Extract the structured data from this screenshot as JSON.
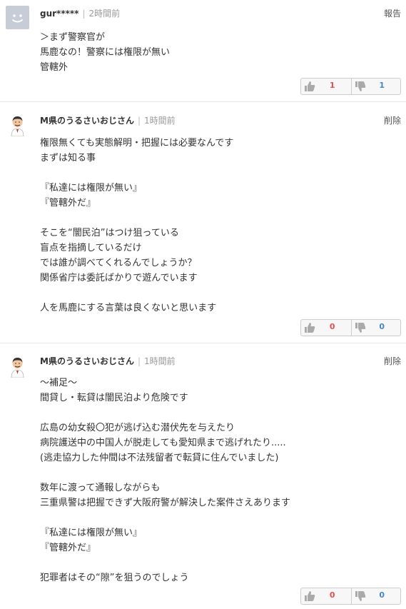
{
  "comments": [
    {
      "username": "gur*****",
      "time": "2時間前",
      "action": "報告",
      "lines": [
        "＞まず警察官が",
        "馬鹿なの！警察には権限が無い",
        "管轄外"
      ],
      "good": "1",
      "bad": "1"
    },
    {
      "username": "M県のうるさいおじさん",
      "time": "1時間前",
      "action": "削除",
      "lines": [
        "権限無くても実態解明・把握には必要なんです",
        "まずは知る事",
        "",
        "『私達には権限が無い』",
        "『管轄外だ』",
        "",
        "そこを“闇民泊”はつけ狙っている",
        "盲点を指摘しているだけ",
        "では誰が調べてくれるんでしょうか？",
        "関係省庁は委託ばかりで遊んでいます",
        "",
        "人を馬鹿にする言葉は良くないと思います"
      ],
      "good": "0",
      "bad": "0"
    },
    {
      "username": "M県のうるさいおじさん",
      "time": "1時間前",
      "action": "削除",
      "lines": [
        "～補足～",
        "間貸し・転貸は闇民泊より危険です",
        "",
        "広島の幼女殺〇犯が逃げ込む潜伏先を与えたり",
        "病院護送中の中国人が脱走しても愛知県まで逃げれたり.....",
        "(逃走協力した仲間は不法残留者で転貸に住んでいました)",
        "",
        "数年に渡って通報しながらも",
        "三重県警は把握できず大阪府警が解決した案件さえあります",
        "",
        "『私達には権限が無い』",
        "『管轄外だ』",
        "",
        "犯罪者はその“隙”を狙うのでしょう"
      ],
      "good": "0",
      "bad": "0"
    }
  ]
}
